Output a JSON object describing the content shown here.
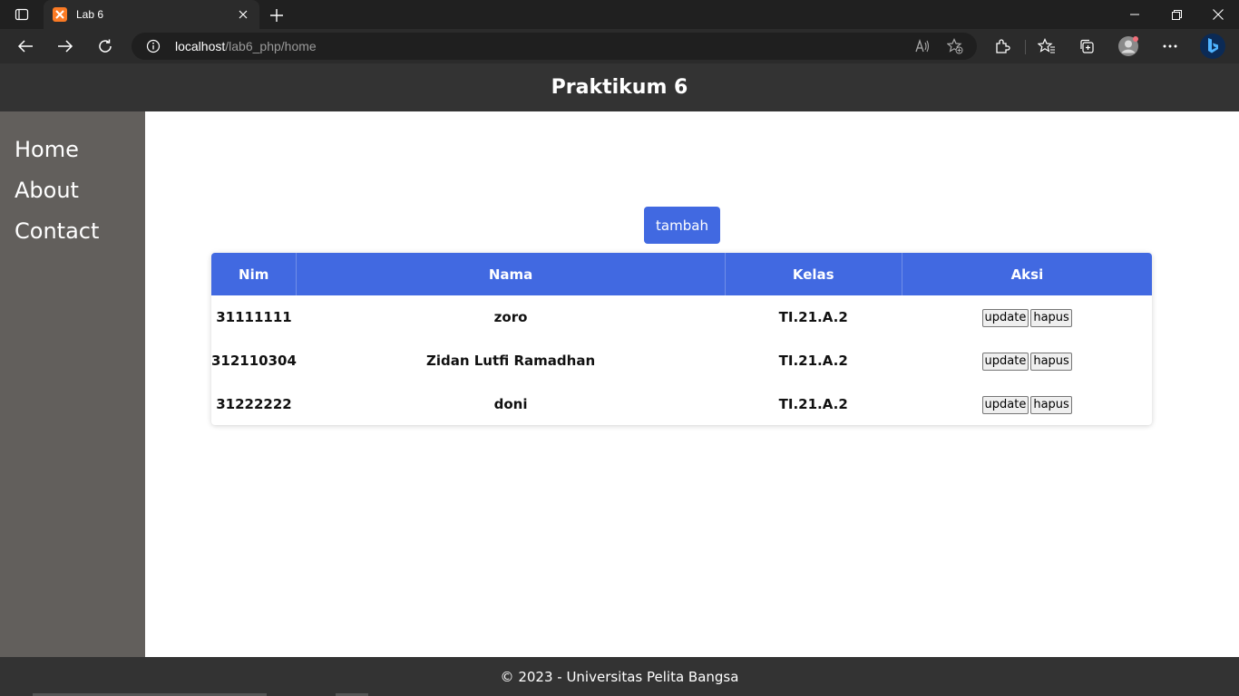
{
  "browser": {
    "tab_title": "Lab 6",
    "url_host": "localhost",
    "url_path": "/lab6_php/home"
  },
  "site": {
    "title": "Praktikum 6",
    "nav": [
      "Home",
      "About",
      "Contact"
    ],
    "add_button": "tambah",
    "table": {
      "headers": [
        "Nim",
        "Nama",
        "Kelas",
        "Aksi"
      ],
      "rows": [
        {
          "nim": "31111111",
          "nama": "zoro",
          "kelas": "TI.21.A.2"
        },
        {
          "nim": "312110304",
          "nama": "Zidan Lutfi Ramadhan",
          "kelas": "TI.21.A.2"
        },
        {
          "nim": "31222222",
          "nama": "doni",
          "kelas": "TI.21.A.2"
        }
      ],
      "update_label": "update",
      "delete_label": "hapus"
    },
    "footer": "© 2023 - Universitas Pelita Bangsa"
  },
  "colors": {
    "header_bg": "#333333",
    "sidebar_bg": "#625f5c",
    "accent": "#4169e1"
  }
}
